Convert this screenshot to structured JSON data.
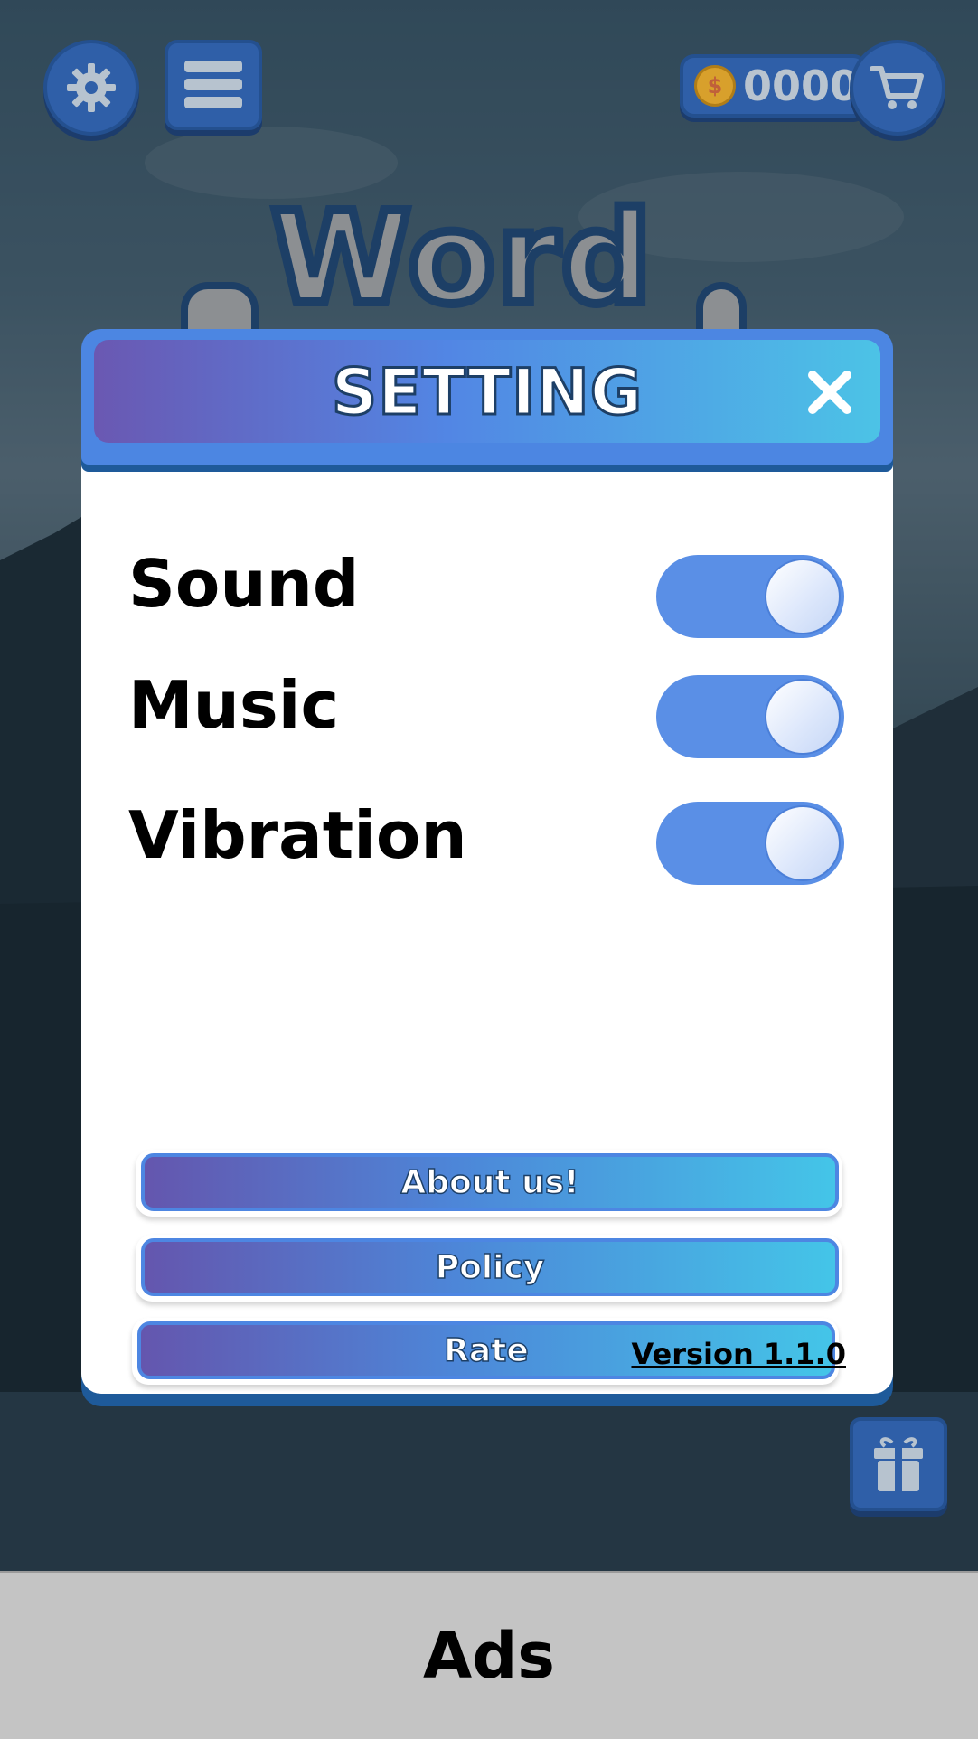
{
  "top_bar": {
    "settings_icon": "gear-icon",
    "menu_icon": "hamburger-menu-icon",
    "coins": "0000",
    "coin_symbol": "$",
    "shop_icon": "shopping-cart-icon"
  },
  "logo": {
    "text": "Word"
  },
  "modal": {
    "title": "SETTING",
    "close_icon": "close-icon",
    "settings": [
      {
        "label": "Sound",
        "enabled": true
      },
      {
        "label": "Music",
        "enabled": true
      },
      {
        "label": "Vibration",
        "enabled": true
      }
    ],
    "buttons": [
      {
        "label": "About us!"
      },
      {
        "label": "Policy"
      },
      {
        "label": "Rate"
      }
    ],
    "version": "Version 1.1.0"
  },
  "gift_icon": "gift-icon",
  "ads": {
    "label": "Ads"
  },
  "colors": {
    "accent": "#4c86e2",
    "toggle_on": "#5a8fe6",
    "button_gradient_start": "#6456ae",
    "button_gradient_end": "#44c5e8"
  }
}
